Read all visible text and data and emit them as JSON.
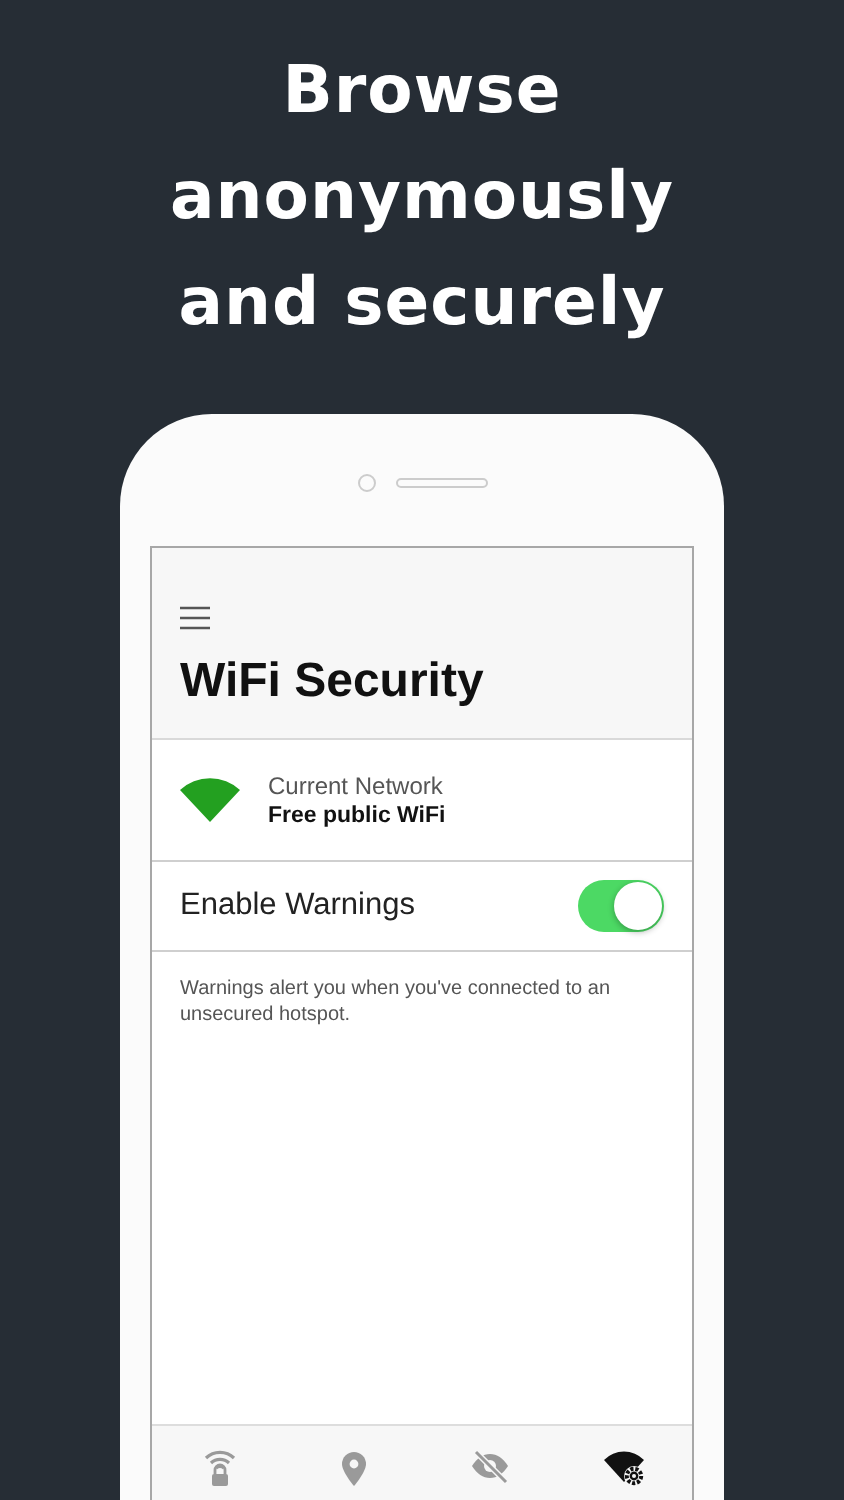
{
  "headline": [
    "Browse",
    "anonymously",
    "and securely"
  ],
  "screen": {
    "title": "WiFi Security",
    "network": {
      "label": "Current Network",
      "name": "Free public WiFi"
    },
    "warnings": {
      "label": "Enable Warnings",
      "on": true
    },
    "note": "Warnings alert you when you've connected to an unsecured hotspot.",
    "tabs": [
      {
        "kind": "wifi-lock",
        "selected": false
      },
      {
        "kind": "location",
        "selected": false
      },
      {
        "kind": "eye-off",
        "selected": false
      },
      {
        "kind": "wifi-gear",
        "selected": true
      }
    ]
  }
}
